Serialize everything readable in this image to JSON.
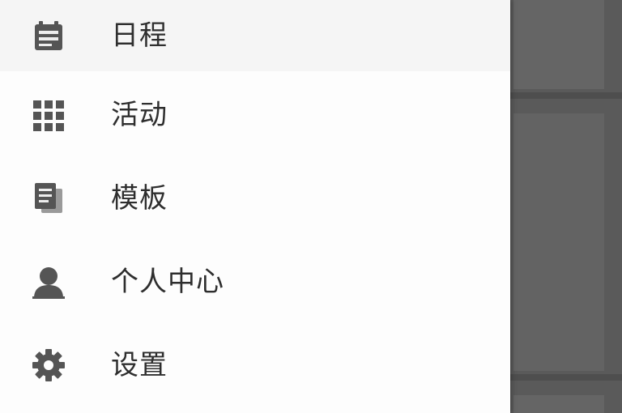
{
  "drawer": {
    "items": [
      {
        "label": "日程",
        "icon": "calendar-icon",
        "active": true
      },
      {
        "label": "活动",
        "icon": "grid-icon",
        "active": false
      },
      {
        "label": "模板",
        "icon": "document-stack-icon",
        "active": false
      },
      {
        "label": "个人中心",
        "icon": "person-icon",
        "active": false
      },
      {
        "label": "设置",
        "icon": "gear-icon",
        "active": false
      }
    ]
  },
  "colors": {
    "drawer_background": "#fdfdfd",
    "active_item_background": "#f5f5f5",
    "text": "#2e2e2e",
    "icon": "#555555",
    "scrim": "#5c5c5c"
  }
}
